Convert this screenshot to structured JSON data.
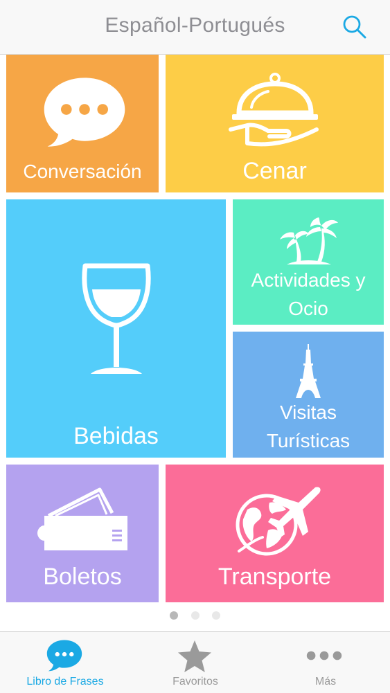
{
  "header": {
    "title": "Español-Portugués",
    "search_icon": "search-icon"
  },
  "colors": {
    "conversacion": "#f6a646",
    "cenar": "#fdcd47",
    "bebidas": "#54cdfa",
    "actividades": "#5bedc3",
    "visitas": "#6fb0ee",
    "boletos": "#b4a2ef",
    "transporte": "#fb6d98",
    "accent": "#1ba9e4"
  },
  "tiles": {
    "conversacion": {
      "label": "Conversación",
      "icon": "speech-bubble-icon"
    },
    "cenar": {
      "label": "Cenar",
      "icon": "food-cloche-icon"
    },
    "bebidas": {
      "label": "Bebidas",
      "icon": "wine-glass-icon"
    },
    "actividades": {
      "label_line1": "Actividades y",
      "label_line2": "Ocio",
      "icon": "palm-trees-icon"
    },
    "visitas": {
      "label_line1": "Visitas",
      "label_line2": "Turísticas",
      "icon": "eiffel-tower-icon"
    },
    "boletos": {
      "label": "Boletos",
      "icon": "ticket-icon"
    },
    "transporte": {
      "label": "Transporte",
      "icon": "globe-plane-icon"
    }
  },
  "pager": {
    "pages": 3,
    "current": 1
  },
  "tabbar": {
    "items": [
      {
        "label": "Libro de Frases",
        "icon": "speech-bubble-icon",
        "active": true
      },
      {
        "label": "Favoritos",
        "icon": "star-icon",
        "active": false
      },
      {
        "label": "Más",
        "icon": "more-dots-icon",
        "active": false
      }
    ]
  }
}
